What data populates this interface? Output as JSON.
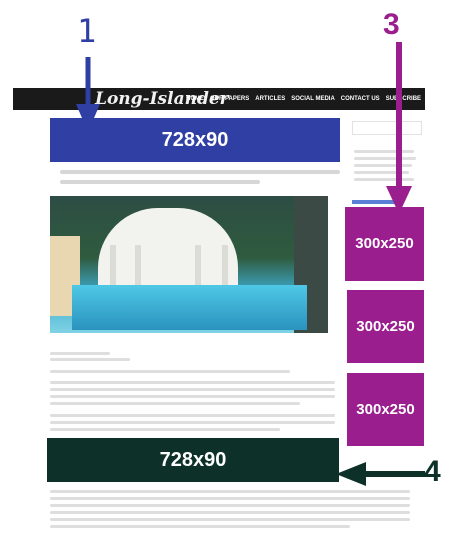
{
  "site": {
    "logo_text": "Long-Islander",
    "nav_items": [
      "HOME",
      "OUR PAPERS",
      "ARTICLES",
      "SOCIAL MEDIA",
      "CONTACT US",
      "SUBSCRIBE"
    ]
  },
  "ads": {
    "leaderboard_top": "728x90",
    "leaderboard_bottom": "728x90",
    "rect_1": "300x250",
    "rect_2": "300x250",
    "rect_3": "300x250"
  },
  "labels": {
    "one": "1",
    "three": "3",
    "four": "4"
  },
  "colors": {
    "blue": "#2f3fa4",
    "purple": "#9a1e8e",
    "green": "#0d3128"
  }
}
